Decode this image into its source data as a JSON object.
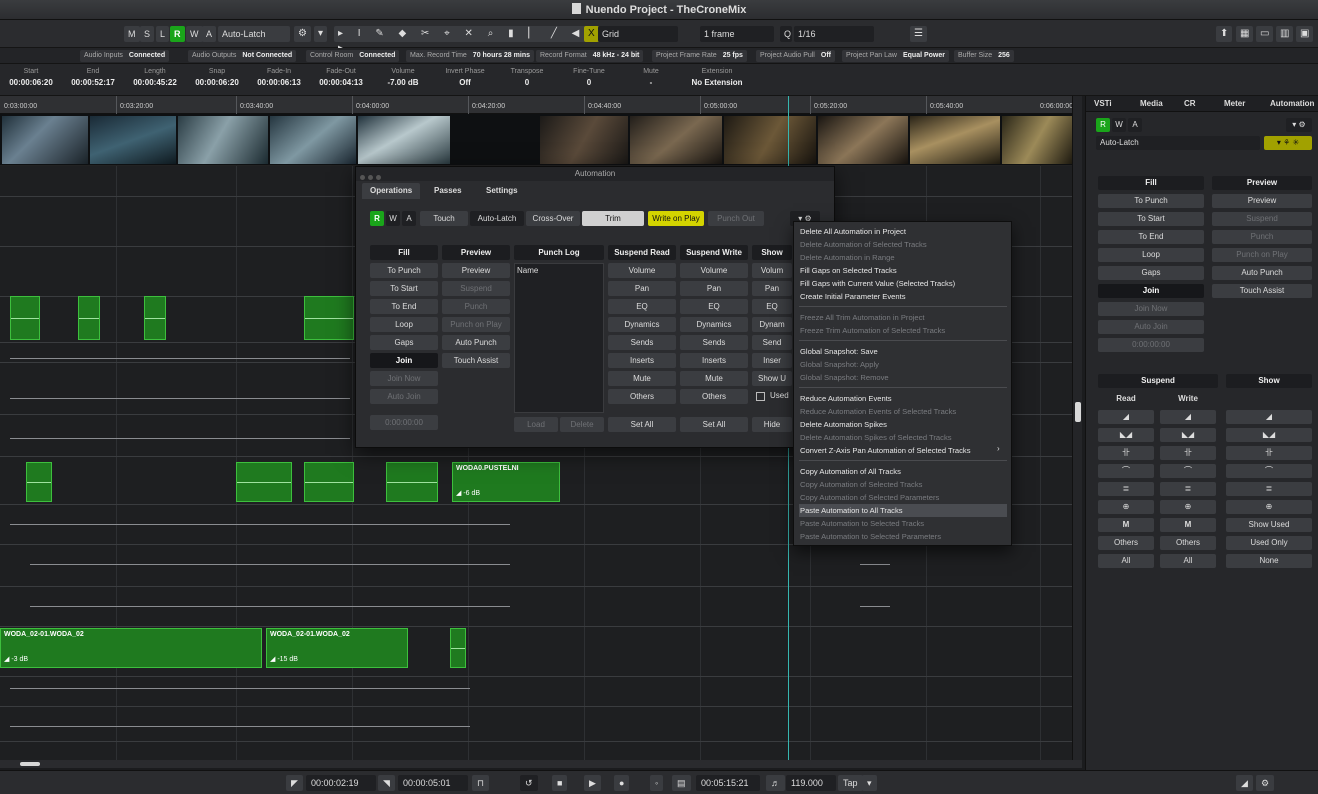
{
  "window": {
    "title": "Nuendo Project - TheCroneMix"
  },
  "toolbar": {
    "m": "M",
    "s": "S",
    "l": "L",
    "r": "R",
    "w": "W",
    "a": "A",
    "automation_mode": "Auto-Latch",
    "grid_type": "Grid",
    "quantize_frame": "1 frame",
    "quantize_value": "1/16",
    "q_label": "Q"
  },
  "status": {
    "audio_inputs_label": "Audio Inputs",
    "audio_inputs_value": "Connected",
    "audio_outputs_label": "Audio Outputs",
    "audio_outputs_value": "Not Connected",
    "control_room_label": "Control Room",
    "control_room_value": "Connected",
    "max_record_label": "Max. Record Time",
    "max_record_value": "70 hours 28 mins",
    "record_format_label": "Record Format",
    "record_format_value": "48 kHz - 24 bit",
    "frame_rate_label": "Project Frame Rate",
    "frame_rate_value": "25 fps",
    "pull_label": "Project Audio Pull",
    "pull_value": "Off",
    "pan_law_label": "Project Pan Law",
    "pan_law_value": "Equal Power",
    "buffer_label": "Buffer Size",
    "buffer_value": "256"
  },
  "infoline": [
    {
      "key": "Start",
      "value": "00:00:06:20"
    },
    {
      "key": "End",
      "value": "00:00:52:17"
    },
    {
      "key": "Length",
      "value": "00:00:45:22"
    },
    {
      "key": "Snap",
      "value": "00:00:06:20"
    },
    {
      "key": "Fade-In",
      "value": "00:00:06:13"
    },
    {
      "key": "Fade-Out",
      "value": "00:00:04:13"
    },
    {
      "key": "Volume",
      "value": "-7.00    dB"
    },
    {
      "key": "Invert Phase",
      "value": "Off"
    },
    {
      "key": "Transpose",
      "value": "0"
    },
    {
      "key": "Fine-Tune",
      "value": "0"
    },
    {
      "key": "Mute",
      "value": "-"
    },
    {
      "key": "Extension",
      "value": "No Extension"
    }
  ],
  "ruler": [
    "0:03:00:00",
    "0:03:20:00",
    "0:03:40:00",
    "0:04:00:00",
    "0:04:20:00",
    "0:04:40:00",
    "0:05:00:00",
    "0:05:20:00",
    "0:05:40:00",
    "0:06:00:00"
  ],
  "clips": {
    "woda_a": "WODA0.PUSTELNI",
    "woda_a_vol": "◢ -6 dB",
    "woda_b": "WODA_02-01.WODA_02",
    "woda_b_vol": "◢ -3 dB",
    "woda_c": "WODA_02-01.WODA_02",
    "woda_c_vol": "◢ -15 dB"
  },
  "dialog": {
    "title": "Automation",
    "tabs": [
      "Operations",
      "Passes",
      "Settings"
    ],
    "modes": [
      "Touch",
      "Auto-Latch",
      "Cross-Over"
    ],
    "trim": "Trim",
    "write_on_play": "Write on Play",
    "punch_out": "Punch Out",
    "fill_header": "Fill",
    "preview_header": "Preview",
    "punchlog_header": "Punch Log",
    "suspend_read_header": "Suspend Read",
    "suspend_write_header": "Suspend Write",
    "show_header": "Show",
    "fill": [
      "To Punch",
      "To Start",
      "To End",
      "Loop",
      "Gaps",
      "Join",
      "Join Now",
      "Auto Join"
    ],
    "preview": [
      "Preview",
      "Suspend",
      "Punch",
      "Punch on Play",
      "Auto Punch",
      "Touch Assist"
    ],
    "params": [
      "Volume",
      "Pan",
      "EQ",
      "Dynamics",
      "Sends",
      "Inserts",
      "Mute",
      "Others"
    ],
    "show_params": [
      "Volum",
      "Pan",
      "EQ",
      "Dynam",
      "Send",
      "Inser",
      "Show U"
    ],
    "used_label": "Used",
    "name_col": "Name",
    "load": "Load",
    "delete": "Delete",
    "set_all": "Set All",
    "hide": "Hide",
    "time": "0:00:00:00"
  },
  "menu": [
    {
      "label": "Delete All Automation in Project",
      "enabled": true
    },
    {
      "label": "Delete Automation of Selected Tracks",
      "enabled": false
    },
    {
      "label": "Delete Automation in Range",
      "enabled": false
    },
    {
      "label": "Fill Gaps on Selected Tracks",
      "enabled": true
    },
    {
      "label": "Fill Gaps with Current Value (Selected Tracks)",
      "enabled": true
    },
    {
      "label": "Create Initial Parameter Events",
      "enabled": true
    },
    {
      "label": "Freeze All Trim Automation in Project",
      "enabled": false
    },
    {
      "label": "Freeze Trim Automation of Selected Tracks",
      "enabled": false
    },
    {
      "label": "Global Snapshot: Save",
      "enabled": true
    },
    {
      "label": "Global Snapshot: Apply",
      "enabled": false
    },
    {
      "label": "Global Snapshot: Remove",
      "enabled": false
    },
    {
      "label": "Reduce Automation Events",
      "enabled": true
    },
    {
      "label": "Reduce Automation Events of Selected Tracks",
      "enabled": false
    },
    {
      "label": "Delete Automation Spikes",
      "enabled": true
    },
    {
      "label": "Delete Automation Spikes of Selected Tracks",
      "enabled": false
    },
    {
      "label": "Convert Z-Axis Pan Automation of Selected Tracks",
      "enabled": true
    },
    {
      "label": "Copy Automation of All Tracks",
      "enabled": true
    },
    {
      "label": "Copy Automation of Selected Tracks",
      "enabled": false
    },
    {
      "label": "Copy Automation of Selected Parameters",
      "enabled": false
    },
    {
      "label": "Paste Automation to All Tracks",
      "enabled": true,
      "highlighted": true
    },
    {
      "label": "Paste Automation to Selected Tracks",
      "enabled": false
    },
    {
      "label": "Paste Automation to Selected Parameters",
      "enabled": false
    }
  ],
  "right_panel": {
    "tabs": [
      "VSTi",
      "Media",
      "CR",
      "Meter",
      "Automation"
    ],
    "mode": "Auto-Latch",
    "fill_header": "Fill",
    "preview_header": "Preview",
    "fill": [
      "To Punch",
      "To Start",
      "To End",
      "Loop",
      "Gaps",
      "Join",
      "Join Now",
      "Auto Join"
    ],
    "preview": [
      "Preview",
      "Suspend",
      "Punch",
      "Punch on Play",
      "Auto Punch",
      "Touch Assist"
    ],
    "time": "0:00:00:00",
    "suspend_header": "Suspend",
    "show_header": "Show",
    "read_label": "Read",
    "write_label": "Write",
    "m_label": "M",
    "others": "Others",
    "all": "All",
    "show_used": "Show Used",
    "used_only": "Used Only",
    "none": "None"
  },
  "transport": {
    "left_locator": "00:00:02:19",
    "right_locator": "00:00:05:01",
    "position": "00:05:15:21",
    "tempo": "119.000",
    "tap": "Tap"
  },
  "colors": {
    "clip_green": "#1f7a1f",
    "accent_green": "#1aa51a",
    "playhead": "#36b6b0",
    "write_yellow": "#d4d400"
  }
}
